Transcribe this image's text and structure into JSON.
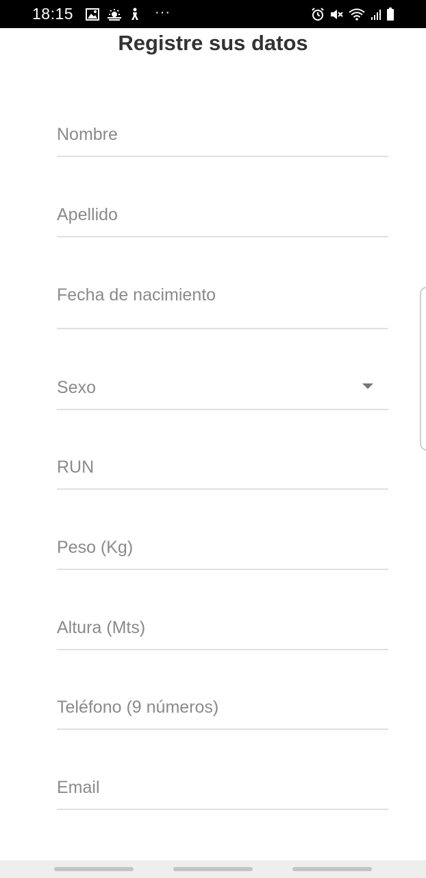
{
  "status_bar": {
    "time": "18:15",
    "left_icons": [
      "image-icon",
      "weather-icon",
      "accessibility-icon"
    ],
    "more": "···",
    "right_icons": [
      "alarm-icon",
      "mute-icon",
      "wifi-icon",
      "signal-icon",
      "battery-icon"
    ]
  },
  "form": {
    "title": "Registre sus datos",
    "fields": [
      {
        "label": "Nombre",
        "type": "text"
      },
      {
        "label": "Apellido",
        "type": "text"
      },
      {
        "label": "Fecha de nacimiento",
        "type": "date"
      },
      {
        "label": "Sexo",
        "type": "select"
      },
      {
        "label": "RUN",
        "type": "text"
      },
      {
        "label": "Peso (Kg)",
        "type": "number"
      },
      {
        "label": "Altura (Mts)",
        "type": "number"
      },
      {
        "label": "Teléfono (9 números)",
        "type": "tel"
      },
      {
        "label": "Email",
        "type": "email"
      }
    ]
  },
  "nav_bar": {
    "buttons": [
      "recent-apps-button",
      "home-button",
      "back-button"
    ]
  },
  "colors": {
    "status_bar_bg": "#000000",
    "title_text": "#333333",
    "label_text": "#8a8a8a",
    "underline": "#e0e0e0",
    "nav_bar_bg": "#eeeeee"
  }
}
